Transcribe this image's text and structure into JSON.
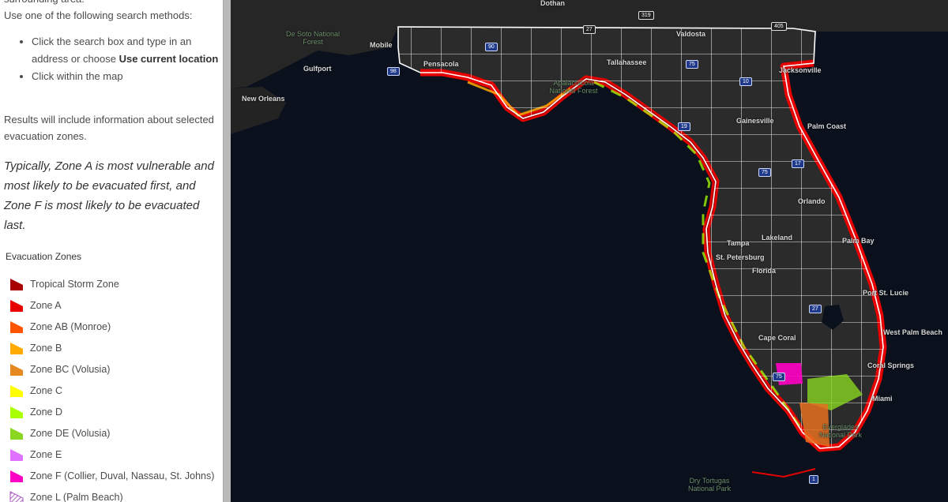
{
  "sidebar": {
    "intro_top": "surrounding area.",
    "intro": "Use one of the following search methods:",
    "methods": [
      {
        "text": "Click the search box and type in an address or choose ",
        "bold": "Use current location"
      },
      {
        "text": "Click within the map",
        "bold": ""
      }
    ],
    "results": "Results will include information about selected evacuation zones.",
    "typical": "Typically, Zone A is most vulnerable and most likely to be evacuated first, and Zone F is most likely to be evacuated last.",
    "legend_title": "Evacuation Zones",
    "legend": [
      {
        "label": "Tropical Storm Zone",
        "color": "#a80000"
      },
      {
        "label": "Zone A",
        "color": "#e60000"
      },
      {
        "label": "Zone AB (Monroe)",
        "color": "#ff5500"
      },
      {
        "label": "Zone B",
        "color": "#ffaa00"
      },
      {
        "label": "Zone BC (Volusia)",
        "color": "#e68a1f"
      },
      {
        "label": "Zone C",
        "color": "#ffff00"
      },
      {
        "label": "Zone D",
        "color": "#aaff00"
      },
      {
        "label": "Zone DE (Volusia)",
        "color": "#8ad620"
      },
      {
        "label": "Zone E",
        "color": "#df73ff"
      },
      {
        "label": "Zone F (Collier, Duval, Nassau, St. Johns)",
        "color": "#ff00c5"
      },
      {
        "label": "Zone L (Palm Beach)",
        "color": "#9a2fb8",
        "hatched": true
      }
    ]
  },
  "map": {
    "colors": {
      "water": "#0a111d",
      "land": "#2b2b2b",
      "county_border": "#ffffff"
    },
    "places": [
      "Dothan",
      "Valdosta",
      "Mobile",
      "Pensacola",
      "Tallahassee",
      "Jacksonville",
      "Gulfport",
      "New Orleans",
      "Apalachicola National Forest",
      "Gainesville",
      "Palm Coast",
      "Orlando",
      "Lakeland",
      "Tampa",
      "St. Petersburg",
      "Florida",
      "Palm Bay",
      "Port St. Lucie",
      "West Palm Beach",
      "Cape Coral",
      "Coral Springs",
      "Miami",
      "Everglades National Park",
      "Dry Tortugas National Park",
      "De Soto National Forest"
    ],
    "shields": [
      "319",
      "27",
      "405",
      "90",
      "98",
      "75",
      "10",
      "19",
      "17",
      "75",
      "27",
      "75",
      "1"
    ]
  }
}
